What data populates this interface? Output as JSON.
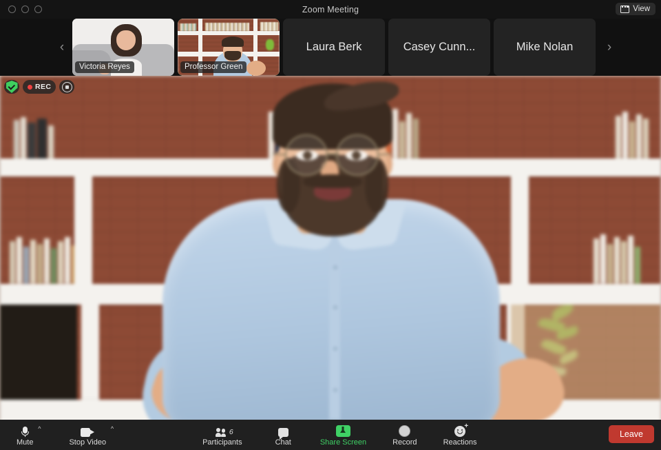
{
  "window": {
    "title": "Zoom Meeting",
    "controls": [
      "close",
      "minimize",
      "maximize"
    ],
    "view_button": {
      "label": "View",
      "icon": "grid-view-icon"
    }
  },
  "filmstrip": {
    "prev_arrow": "‹",
    "next_arrow": "›",
    "participants": [
      {
        "name": "Victoria Reyes",
        "video_on": true,
        "active_speaker": false
      },
      {
        "name": "Professor Green",
        "video_on": true,
        "active_speaker": true
      },
      {
        "name": "Laura Berk",
        "video_on": false,
        "active_speaker": false
      },
      {
        "name": "Casey Cunn...",
        "video_on": false,
        "active_speaker": false
      },
      {
        "name": "Mike Nolan",
        "video_on": false,
        "active_speaker": false
      }
    ]
  },
  "stage": {
    "badges": {
      "security": {
        "icon": "shield-check-icon",
        "color": "#3fcf5f"
      },
      "recording": {
        "label": "REC",
        "dot_color": "#ef4141"
      },
      "stop_recording": {
        "icon": "stop-recording-icon"
      }
    },
    "speaker": "Professor Green"
  },
  "toolbar": {
    "mute": {
      "label": "Mute",
      "icon": "microphone-icon",
      "has_caret": true
    },
    "video": {
      "label": "Stop Video",
      "icon": "video-camera-icon",
      "has_caret": true
    },
    "participants": {
      "label": "Participants",
      "icon": "people-icon",
      "count": "6"
    },
    "chat": {
      "label": "Chat",
      "icon": "chat-bubble-icon"
    },
    "share": {
      "label": "Share Screen",
      "icon": "share-screen-icon",
      "color": "#3fd165"
    },
    "record": {
      "label": "Record",
      "icon": "record-circle-icon"
    },
    "reactions": {
      "label": "Reactions",
      "icon": "smiley-plus-icon"
    },
    "leave": {
      "label": "Leave",
      "color": "#c0392f"
    }
  }
}
